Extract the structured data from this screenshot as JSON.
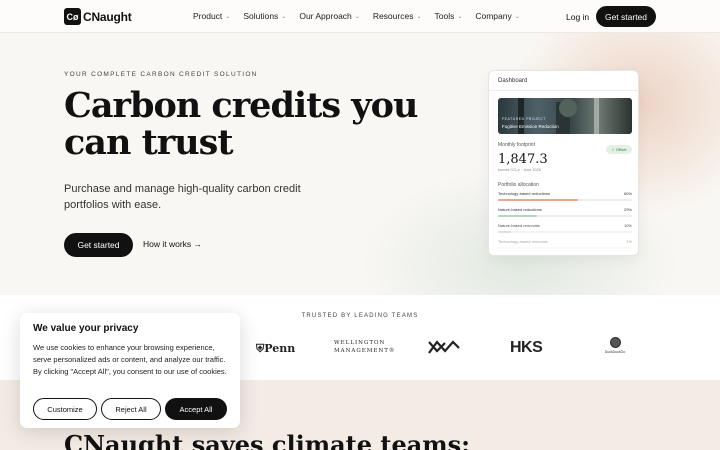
{
  "header": {
    "logo_mark": "Cø",
    "logo_text": "CNaught",
    "menu": [
      {
        "label": "Product"
      },
      {
        "label": "Solutions"
      },
      {
        "label": "Our Approach"
      },
      {
        "label": "Resources"
      },
      {
        "label": "Tools"
      },
      {
        "label": "Company"
      }
    ],
    "login": "Log in",
    "cta": "Get started"
  },
  "hero": {
    "eyebrow": "YOUR COMPLETE CARBON CREDIT SOLUTION",
    "headline": "Carbon credits you can trust",
    "subtext": "Purchase and manage high-quality carbon credit portfolios with ease.",
    "cta": "Get started",
    "secondary": "How it works →"
  },
  "dashboard": {
    "title": "Dashboard",
    "project_label": "FEATURED PROJECT",
    "project_name": "Fugitive Emission Reduction",
    "footprint_label": "Monthly footprint",
    "footprint_value": "1,847.3",
    "footprint_unit": "tonnes CO₂e · June 2026",
    "status": "✓ Offset",
    "allocation_label": "Portfolio allocation",
    "allocations": [
      {
        "name": "Technology-based reductions",
        "pct": "60%",
        "value": 0.6,
        "color": "#e8a88a"
      },
      {
        "name": "Nature-based reductions",
        "pct": "29%",
        "value": 0.29,
        "color": "#b9d3c2"
      },
      {
        "name": "Nature-based removals",
        "pct": "10%",
        "value": 0.1,
        "color": "#c9d8cd"
      },
      {
        "name": "Technology-based removals",
        "pct": "1%",
        "value": 0.01,
        "color": "#c9c9c9"
      }
    ]
  },
  "trusted": {
    "label": "TRUSTED BY LEADING TEAMS",
    "logos": {
      "penn": "Penn",
      "wellington": [
        "WELLINGTON",
        "MANAGEMENT®"
      ],
      "hks": "HKS",
      "dd": "DuckDuckGo"
    }
  },
  "bottom": {
    "headline": "CNaught saves climate teams:"
  },
  "cookie": {
    "title": "We value your privacy",
    "text": "We use cookies to enhance your browsing experience, serve personalized ads or content, and analyze our traffic. By clicking \"Accept All\", you consent to our use of cookies.",
    "customize": "Customize",
    "reject": "Reject All",
    "accept": "Accept All"
  }
}
